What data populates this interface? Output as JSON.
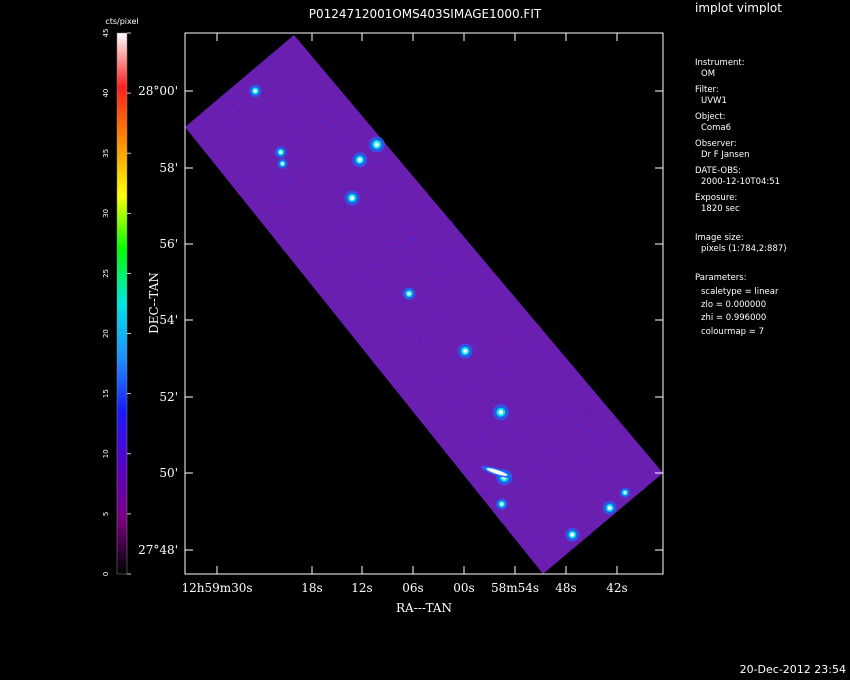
{
  "window_title": "implot vimplot",
  "image_title": "P0124712001OMS403SIMAGE1000.FIT",
  "colorbar": {
    "label": "cts/pixel",
    "ticks": [
      "0",
      "5",
      "10",
      "15",
      "20",
      "25",
      "30",
      "35",
      "40",
      "45"
    ],
    "range": [
      0,
      45
    ],
    "colormap": [
      "#000000",
      "#7a0080",
      "#5a00c8",
      "#1a1aff",
      "#1e90ff",
      "#00e5e5",
      "#00ff00",
      "#ffff00",
      "#ff8c00",
      "#ff2020",
      "#ffffff"
    ]
  },
  "info_panel": {
    "instrument_label": "Instrument:",
    "instrument_value": "OM",
    "filter_label": "Filter:",
    "filter_value": "UVW1",
    "object_label": "Object:",
    "object_value": "Coma6",
    "observer_label": "Observer:",
    "observer_value": "Dr F Jansen",
    "date_label": "DATE-OBS:",
    "date_value": "2000-12-10T04:51",
    "exposure_label": "Exposure:",
    "exposure_value": "1820 sec",
    "size_label": "Image size:",
    "size_value": "pixels (1:784,2:887)",
    "params_label": "Parameters:",
    "param_scaletype": "scaletype = linear",
    "param_zlo": "zlo = 0.000000",
    "param_zhi": "zhi = 0.996000",
    "param_colourmap": "colourmap =   7"
  },
  "timestamp": "20-Dec-2012 23:54",
  "chart_data": {
    "type": "heatmap",
    "title": "P0124712001OMS403SIMAGE1000.FIT",
    "xlabel": "RA---TAN",
    "ylabel": "DEC--TAN",
    "x_ticks": [
      "12h59m30s",
      "18s",
      "12s",
      "06s",
      "00s",
      "58m54s",
      "48s",
      "42s"
    ],
    "y_ticks": [
      "28°00'",
      "58'",
      "56'",
      "54'",
      "52'",
      "50'",
      "27°48'"
    ],
    "background_color": "#6a1fb0",
    "sources": [
      {
        "ra_s": 25.5,
        "dec_m": 60.0,
        "brightness": 0.7
      },
      {
        "ra_s": 22.5,
        "dec_m": 58.4,
        "brightness": 0.6
      },
      {
        "ra_s": 22.3,
        "dec_m": 58.1,
        "brightness": 0.5
      },
      {
        "ra_s": 13.2,
        "dec_m": 58.2,
        "brightness": 0.9
      },
      {
        "ra_s": 11.2,
        "dec_m": 58.6,
        "brightness": 1.0
      },
      {
        "ra_s": 14.1,
        "dec_m": 57.2,
        "brightness": 0.9
      },
      {
        "ra_s": 7.4,
        "dec_m": 54.7,
        "brightness": 0.7
      },
      {
        "ra_s": 0.8,
        "dec_m": 53.2,
        "brightness": 0.9
      },
      {
        "ra_s": 56.6,
        "dec_m": 51.6,
        "brightness": 1.0
      },
      {
        "ra_s": 56.2,
        "dec_m": 49.9,
        "brightness": 1.0
      },
      {
        "ra_s": 56.5,
        "dec_m": 49.2,
        "brightness": 0.6
      },
      {
        "ra_s": 48.2,
        "dec_m": 48.4,
        "brightness": 0.8
      },
      {
        "ra_s": 43.8,
        "dec_m": 49.1,
        "brightness": 0.8
      },
      {
        "ra_s": 42.0,
        "dec_m": 49.5,
        "brightness": 0.5
      }
    ]
  }
}
